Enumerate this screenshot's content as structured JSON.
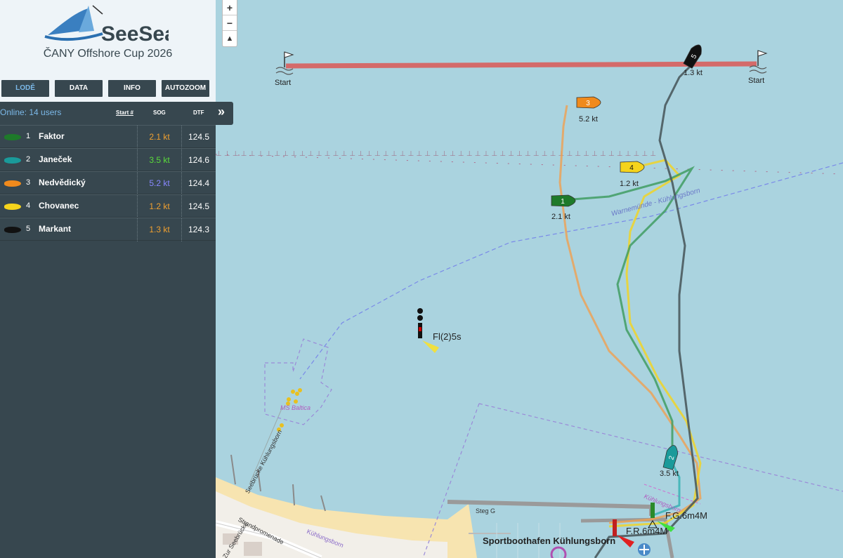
{
  "brand": {
    "logo_text": "SeeSea",
    "event_title": "ČANY Offshore Cup 2026"
  },
  "nav": {
    "boats": "LODĚ",
    "data": "DATA",
    "info": "INFO",
    "autozoom": "AUTOZOOM"
  },
  "list": {
    "online": "Online: 14 users",
    "start_header": "Start #",
    "sog_header": "SOG",
    "dtf_header": "DTF",
    "expand_icon": "»"
  },
  "boats": [
    {
      "num": "1",
      "name": "Faktor",
      "sog": "2.1 kt",
      "dtf": "124.5",
      "color": "#1e7a2a",
      "sog_color": "#f0a030"
    },
    {
      "num": "2",
      "name": "Janeček",
      "sog": "3.5 kt",
      "dtf": "124.6",
      "color": "#1a9a9a",
      "sog_color": "#5adc3a"
    },
    {
      "num": "3",
      "name": "Nedvědický",
      "sog": "5.2 kt",
      "dtf": "124.4",
      "color": "#f08a1c",
      "sog_color": "#8888ff"
    },
    {
      "num": "4",
      "name": "Chovanec",
      "sog": "1.2 kt",
      "dtf": "124.5",
      "color": "#f5d41c",
      "sog_color": "#f0a030"
    },
    {
      "num": "5",
      "name": "Markant",
      "sog": "1.3 kt",
      "dtf": "124.3",
      "color": "#111111",
      "sog_color": "#f0a030"
    }
  ],
  "map": {
    "zoom_in": "+",
    "zoom_out": "−",
    "north": "▲",
    "start_left": "Start",
    "start_right": "Start",
    "boat_labels": [
      "1",
      "2",
      "3",
      "4",
      "5"
    ],
    "speed_labels": [
      "2.1 kt",
      "3.5 kt",
      "5.2 kt",
      "1.2 kt",
      "1.3 kt"
    ],
    "light_fl": "Fl(2)5s",
    "light_fg": "F.G.6m4M",
    "light_fr": "F.R.6m4M",
    "route_label": "Warnemünde - Kühlungsborn",
    "ms_baltica": "MS Baltica",
    "seebruecke": "Seebrücke Kühlungsborn",
    "steg": "Steg G",
    "kuehlungsborn_pink": "Kühlungsborn",
    "harbour": "Sportboothafen Kühlungsborn",
    "strandpromenade": "Strandpromenade",
    "zur_seebruecke": "Zur Seebrücke",
    "kuehlungsborn_beach": "Kühlungsborn"
  }
}
